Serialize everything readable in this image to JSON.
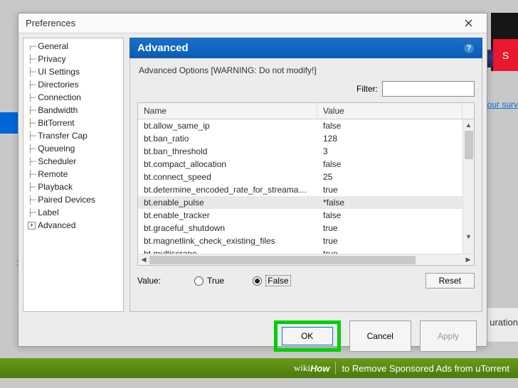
{
  "dialog": {
    "title": "Preferences"
  },
  "sidebar": {
    "items": [
      {
        "label": "General"
      },
      {
        "label": "Privacy"
      },
      {
        "label": "UI Settings"
      },
      {
        "label": "Directories"
      },
      {
        "label": "Connection"
      },
      {
        "label": "Bandwidth"
      },
      {
        "label": "BitTorrent"
      },
      {
        "label": "Transfer Cap"
      },
      {
        "label": "Queueing"
      },
      {
        "label": "Scheduler"
      },
      {
        "label": "Remote"
      },
      {
        "label": "Playback"
      },
      {
        "label": "Paired Devices"
      },
      {
        "label": "Label"
      },
      {
        "label": "Advanced",
        "expandable": true
      }
    ]
  },
  "section": {
    "header": "Advanced",
    "warning": "Advanced Options [WARNING: Do not modify!]",
    "filter_label": "Filter:",
    "filter_value": ""
  },
  "table": {
    "columns": {
      "name": "Name",
      "value": "Value"
    },
    "rows": [
      {
        "name": "bt.allow_same_ip",
        "value": "false"
      },
      {
        "name": "bt.ban_ratio",
        "value": "128"
      },
      {
        "name": "bt.ban_threshold",
        "value": "3"
      },
      {
        "name": "bt.compact_allocation",
        "value": "false"
      },
      {
        "name": "bt.connect_speed",
        "value": "25"
      },
      {
        "name": "bt.determine_encoded_rate_for_streamables",
        "value": "true"
      },
      {
        "name": "bt.enable_pulse",
        "value": "*false",
        "selected": true
      },
      {
        "name": "bt.enable_tracker",
        "value": "false"
      },
      {
        "name": "bt.graceful_shutdown",
        "value": "true"
      },
      {
        "name": "bt.magnetlink_check_existing_files",
        "value": "true"
      },
      {
        "name": "bt.multiscrape",
        "value": "true"
      }
    ]
  },
  "value_editor": {
    "label": "Value:",
    "true_label": "True",
    "false_label": "False",
    "selected": "false",
    "reset_label": "Reset"
  },
  "buttons": {
    "ok": "OK",
    "cancel": "Cancel",
    "apply": "Apply"
  },
  "footer": {
    "brand_wiki": "wiki",
    "brand_how": "How",
    "article": "to Remove Sponsored Ads from uTorrent"
  },
  "background": {
    "close_x": "✕",
    "red_text": "S",
    "link_text": "ke our surv",
    "uration": "uration"
  }
}
